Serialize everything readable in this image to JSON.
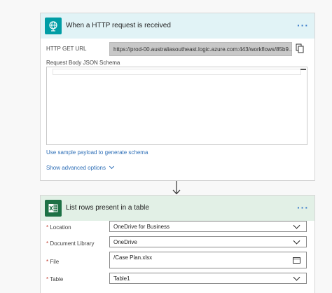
{
  "trigger": {
    "title": "When a HTTP request is received",
    "more": "···",
    "url_label": "HTTP GET URL",
    "url_value": "https://prod-00.australiasoutheast.logic.azure.com:443/workflows/85b9...",
    "schema_label": "Request Body JSON Schema",
    "sample_link": "Use sample payload to generate schema",
    "advanced_link": "Show advanced options",
    "header_color": "#e1f3f6",
    "icon_color": "#009da5"
  },
  "action": {
    "title": "List rows present in a table",
    "more": "···",
    "header_color": "#e2f0e6",
    "icon_color": "#1d7145",
    "fields": [
      {
        "label": "Location",
        "value": "OneDrive for Business"
      },
      {
        "label": "Document Library",
        "value": "OneDrive"
      },
      {
        "label": "File",
        "value": "/Case Plan.xlsx"
      },
      {
        "label": "Table",
        "value": "Table1"
      }
    ]
  },
  "required_marker": "*"
}
